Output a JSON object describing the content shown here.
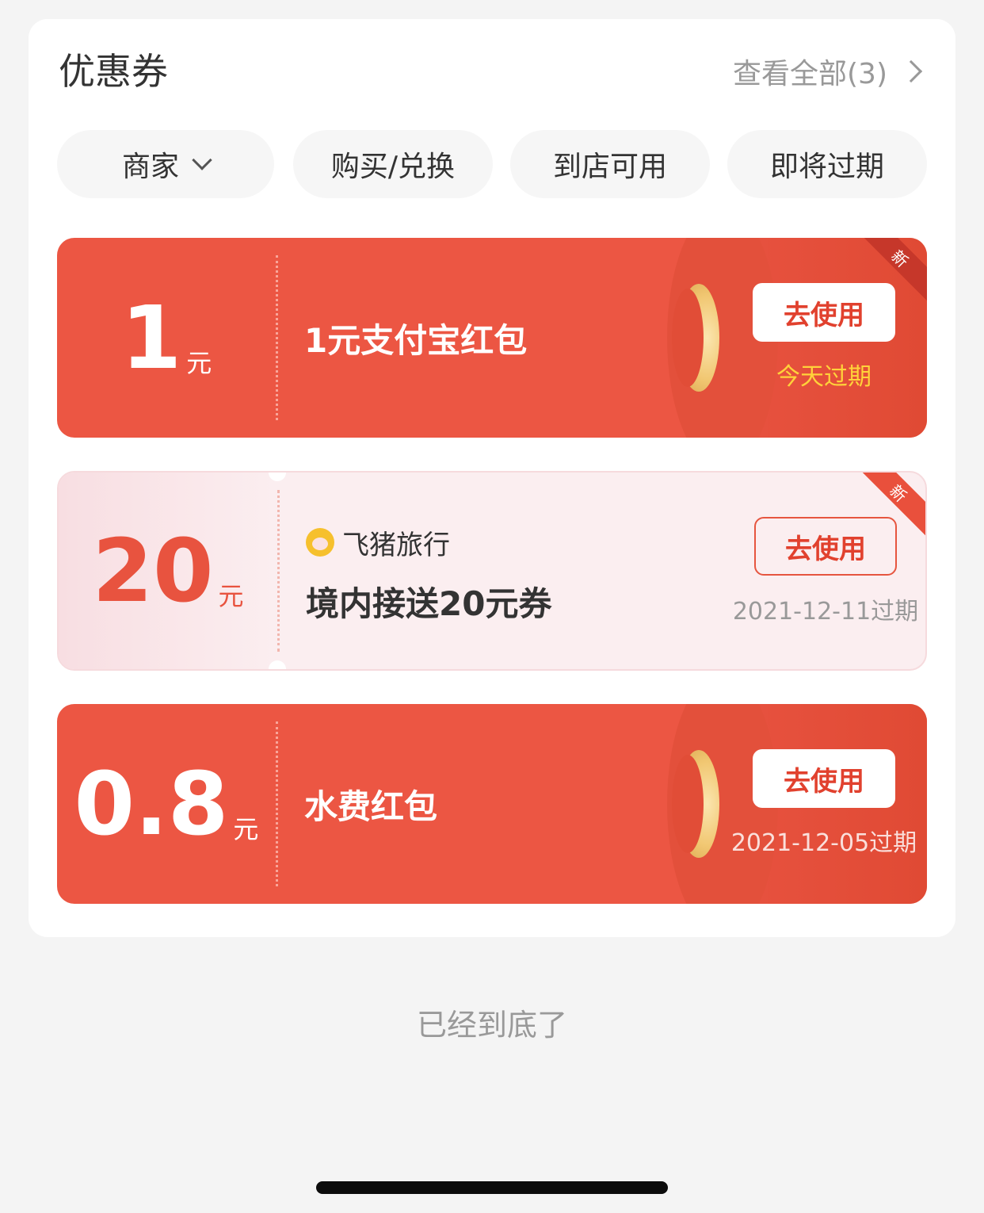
{
  "header": {
    "title": "优惠券",
    "view_all": "查看全部(3)"
  },
  "filters": [
    {
      "label": "商家"
    },
    {
      "label": "购买/兑换"
    },
    {
      "label": "到店可用"
    },
    {
      "label": "即将过期"
    }
  ],
  "coupons": [
    {
      "amount": "1",
      "unit": "元",
      "name": "1元支付宝红包",
      "action": "去使用",
      "expire": "今天过期",
      "badge": "新"
    },
    {
      "amount": "20",
      "unit": "元",
      "merchant": "飞猪旅行",
      "name": "境内接送20元券",
      "action": "去使用",
      "expire": "2021-12-11过期",
      "badge": "新"
    },
    {
      "amount": "0.8",
      "unit": "元",
      "name": "水费红包",
      "action": "去使用",
      "expire": "2021-12-05过期"
    }
  ],
  "footer": {
    "end_text": "已经到底了"
  },
  "colors": {
    "coupon_red": "#ec5643",
    "coupon_pink": "#fbeef0",
    "accent": "#e1412e",
    "expire_today": "#ffd23a"
  }
}
